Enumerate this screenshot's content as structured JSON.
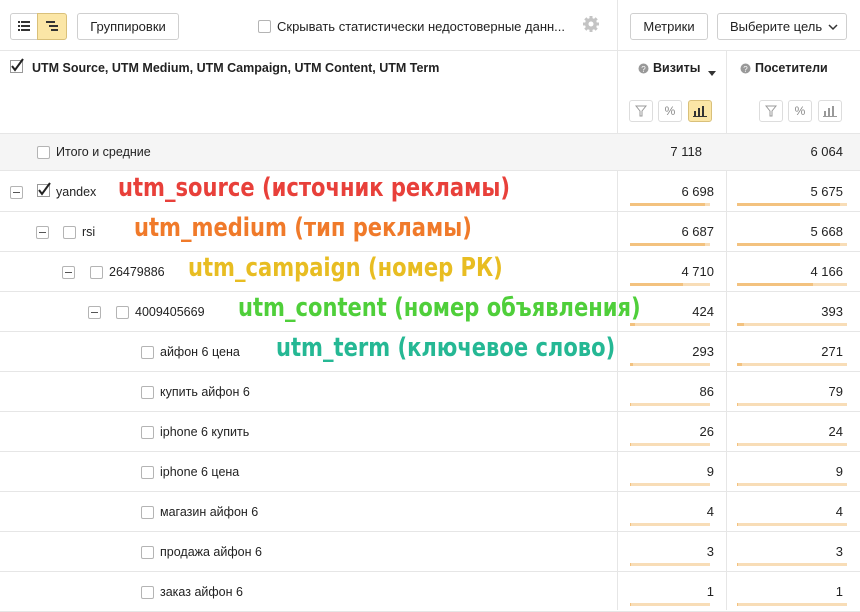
{
  "toolbar": {
    "groupings_label": "Группировки",
    "hide_stat_label": "Скрывать статистически недостоверные данн...",
    "metrics_label": "Метрики",
    "goal_label": "Выберите цель"
  },
  "header": {
    "dimensions_label": "UTM Source, UTM Medium, UTM Campaign, UTM Content, UTM Term",
    "visits_label": "Визиты",
    "visitors_label": "Посетители"
  },
  "totals": {
    "label": "Итого и средние",
    "visits": "7 118",
    "visitors": "6 064"
  },
  "rows": [
    {
      "label": "yandex",
      "visits": "6 698",
      "visitors": "5 675",
      "visits_frac": 0.941,
      "visitors_frac": 0.936
    },
    {
      "label": "rsi",
      "visits": "6 687",
      "visitors": "5 668",
      "visits_frac": 0.939,
      "visitors_frac": 0.935
    },
    {
      "label": "26479886",
      "visits": "4 710",
      "visitors": "4 166",
      "visits_frac": 0.662,
      "visitors_frac": 0.687
    },
    {
      "label": "4009405669",
      "visits": "424",
      "visitors": "393",
      "visits_frac": 0.06,
      "visitors_frac": 0.065
    },
    {
      "label": "айфон 6 цена",
      "visits": "293",
      "visitors": "271",
      "visits_frac": 0.041,
      "visitors_frac": 0.045
    },
    {
      "label": "купить айфон 6",
      "visits": "86",
      "visitors": "79",
      "visits_frac": 0.012,
      "visitors_frac": 0.013
    },
    {
      "label": "iphone 6 купить",
      "visits": "26",
      "visitors": "24",
      "visits_frac": 0.004,
      "visitors_frac": 0.004
    },
    {
      "label": "iphone 6 цена",
      "visits": "9",
      "visitors": "9",
      "visits_frac": 0.001,
      "visitors_frac": 0.001
    },
    {
      "label": "магазин айфон 6",
      "visits": "4",
      "visitors": "4",
      "visits_frac": 0.001,
      "visitors_frac": 0.001
    },
    {
      "label": "продажа айфон 6",
      "visits": "3",
      "visitors": "3",
      "visits_frac": 0.0,
      "visitors_frac": 0.0
    },
    {
      "label": "заказ айфон 6",
      "visits": "1",
      "visitors": "1",
      "visits_frac": 0.0,
      "visitors_frac": 0.0
    }
  ],
  "annotations": {
    "source": "utm_source (источник рекламы)",
    "medium": "utm_medium (тип рекламы)",
    "campaign": "utm_campaign (номер РК)",
    "content": "utm_content (номер объявления)",
    "term": "utm_term (ключевое слово)"
  },
  "colors": {
    "source": "#e8403a",
    "medium": "#f07a2a",
    "campaign": "#e8bd22",
    "content": "#4fcf3a",
    "term": "#25b894",
    "bar_bg": "#f8ddb7",
    "bar_fill": "#f3c27f",
    "active_icon_bg": "#fbe6a6"
  }
}
